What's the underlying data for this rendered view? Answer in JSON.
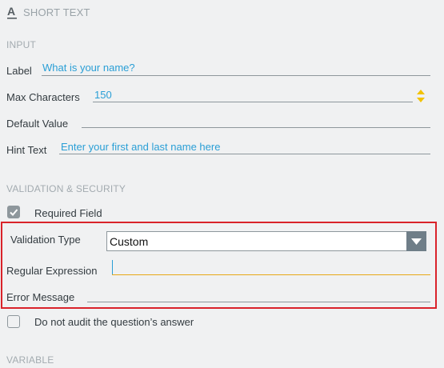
{
  "header": {
    "title": "SHORT TEXT",
    "icon": "text-format-icon"
  },
  "sections": {
    "input": "INPUT",
    "validation": "VALIDATION & SECURITY",
    "variable": "VARIABLE"
  },
  "fields": {
    "label": {
      "label": "Label",
      "value": "What is your name?"
    },
    "max_chars": {
      "label": "Max Characters",
      "value": "150"
    },
    "default_value": {
      "label": "Default Value",
      "value": ""
    },
    "hint_text": {
      "label": "Hint Text",
      "value": "Enter your first and last name here"
    }
  },
  "validation": {
    "required": {
      "label": "Required Field",
      "checked": true
    },
    "type": {
      "label": "Validation Type",
      "selected": "Custom"
    },
    "regex": {
      "label": "Regular Expression",
      "value": ""
    },
    "error": {
      "label": "Error Message",
      "value": ""
    },
    "no_audit": {
      "label": "Do not audit the question’s answer",
      "checked": false
    }
  },
  "colors": {
    "accent": "#2a9fd6",
    "highlight": "#d9232a",
    "focus": "#e6a817",
    "stepper": "#f2c200"
  }
}
